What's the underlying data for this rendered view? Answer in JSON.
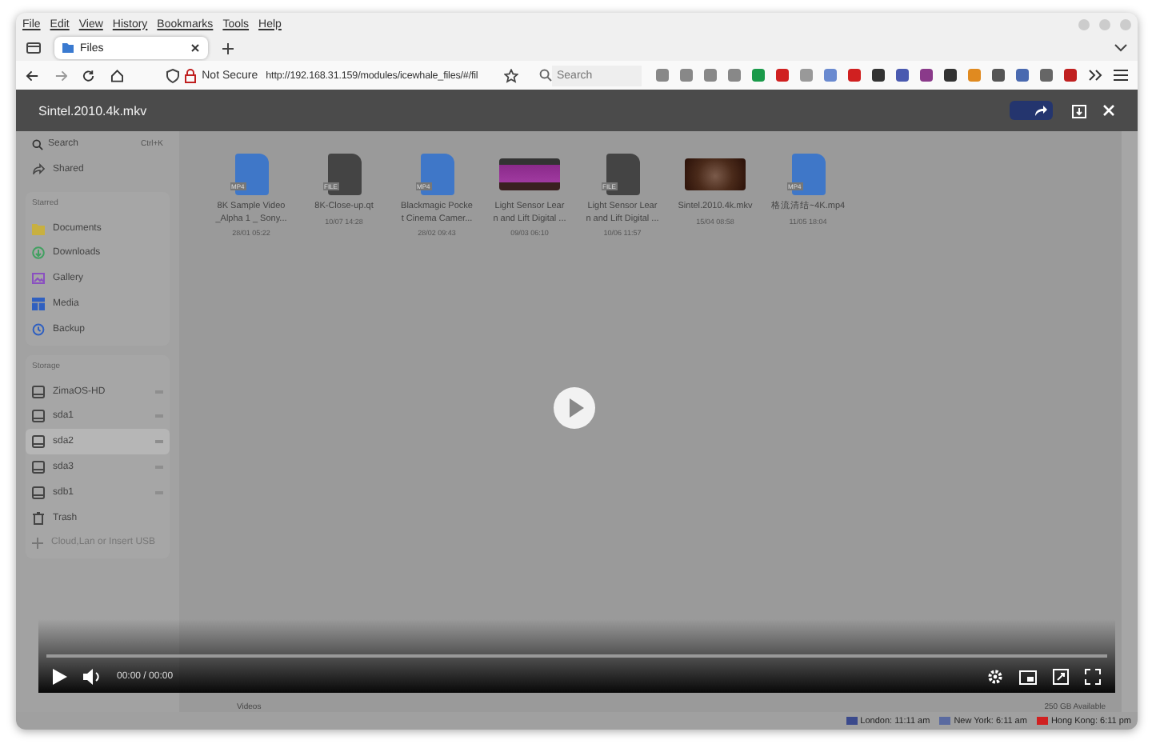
{
  "menu": [
    "File",
    "Edit",
    "View",
    "History",
    "Bookmarks",
    "Tools",
    "Help"
  ],
  "tabs": [
    {
      "label": "Files",
      "selected": true
    }
  ],
  "address": {
    "security": "Not Secure",
    "url": "http://192.168.31.159/modules/icewhale_files/#/fil"
  },
  "search": {
    "placeholder": "Search"
  },
  "player": {
    "title": "Sintel.2010.4k.mkv",
    "time": "00:00 / 00:00"
  },
  "sidebar": {
    "search": {
      "placeholder": "Search",
      "shortcut": "Ctrl+K"
    },
    "shared": "Shared",
    "starred_label": "Starred",
    "places": [
      {
        "label": "Documents",
        "kind": "documents"
      },
      {
        "label": "Downloads",
        "kind": "downloads"
      },
      {
        "label": "Gallery",
        "kind": "gallery"
      },
      {
        "label": "Media",
        "kind": "media"
      },
      {
        "label": "Backup",
        "kind": "backup"
      }
    ],
    "storage_label": "Storage",
    "drives": [
      {
        "label": "ZimaOS-HD",
        "kind": "drive",
        "selected": false
      },
      {
        "label": "sda1",
        "kind": "drive",
        "selected": false
      },
      {
        "label": "sda2",
        "kind": "drive",
        "selected": true
      },
      {
        "label": "sda3",
        "kind": "drive",
        "selected": false
      },
      {
        "label": "sdb1",
        "kind": "drive",
        "selected": false
      },
      {
        "label": "Trash",
        "kind": "trash",
        "selected": false
      }
    ],
    "add": "Cloud,Lan or Insert USB"
  },
  "files": [
    {
      "kind": "video",
      "badge": "MP4",
      "lines": [
        "8K Sample Video",
        "_Alpha 1 _ Sony..."
      ],
      "date": "28/01 05:22"
    },
    {
      "kind": "file",
      "badge": "FILE",
      "lines": [
        "8K-Close-up.qt"
      ],
      "date": "10/07 14:28"
    },
    {
      "kind": "video",
      "badge": "MP4",
      "lines": [
        "Blackmagic Pocke",
        "t Cinema Camer..."
      ],
      "date": "28/02 09:43"
    },
    {
      "kind": "photo",
      "lines": [
        "Light Sensor Lear",
        "n and Lift Digital ..."
      ],
      "date": "09/03 06:10"
    },
    {
      "kind": "file",
      "badge": "FILE",
      "lines": [
        "Light Sensor Lear",
        "n and Lift Digital ..."
      ],
      "date": "10/06 11:57"
    },
    {
      "kind": "frame",
      "lines": [
        "Sintel.2010.4k.mkv"
      ],
      "date": "15/04 08:58"
    },
    {
      "kind": "video",
      "badge": "MP4",
      "lines": [
        "格流清结~4K.mp4"
      ],
      "date": "11/05 18:04"
    }
  ],
  "footer": {
    "path": "Videos",
    "storage": "250 GB Available"
  },
  "clocks": [
    {
      "label": "London: 11:11 am",
      "color": "#3b4a8c"
    },
    {
      "label": "New York: 6:11 am",
      "color": "#5a6aa0"
    },
    {
      "label": "Hong Kong: 6:11 pm",
      "color": "#d02020"
    }
  ]
}
